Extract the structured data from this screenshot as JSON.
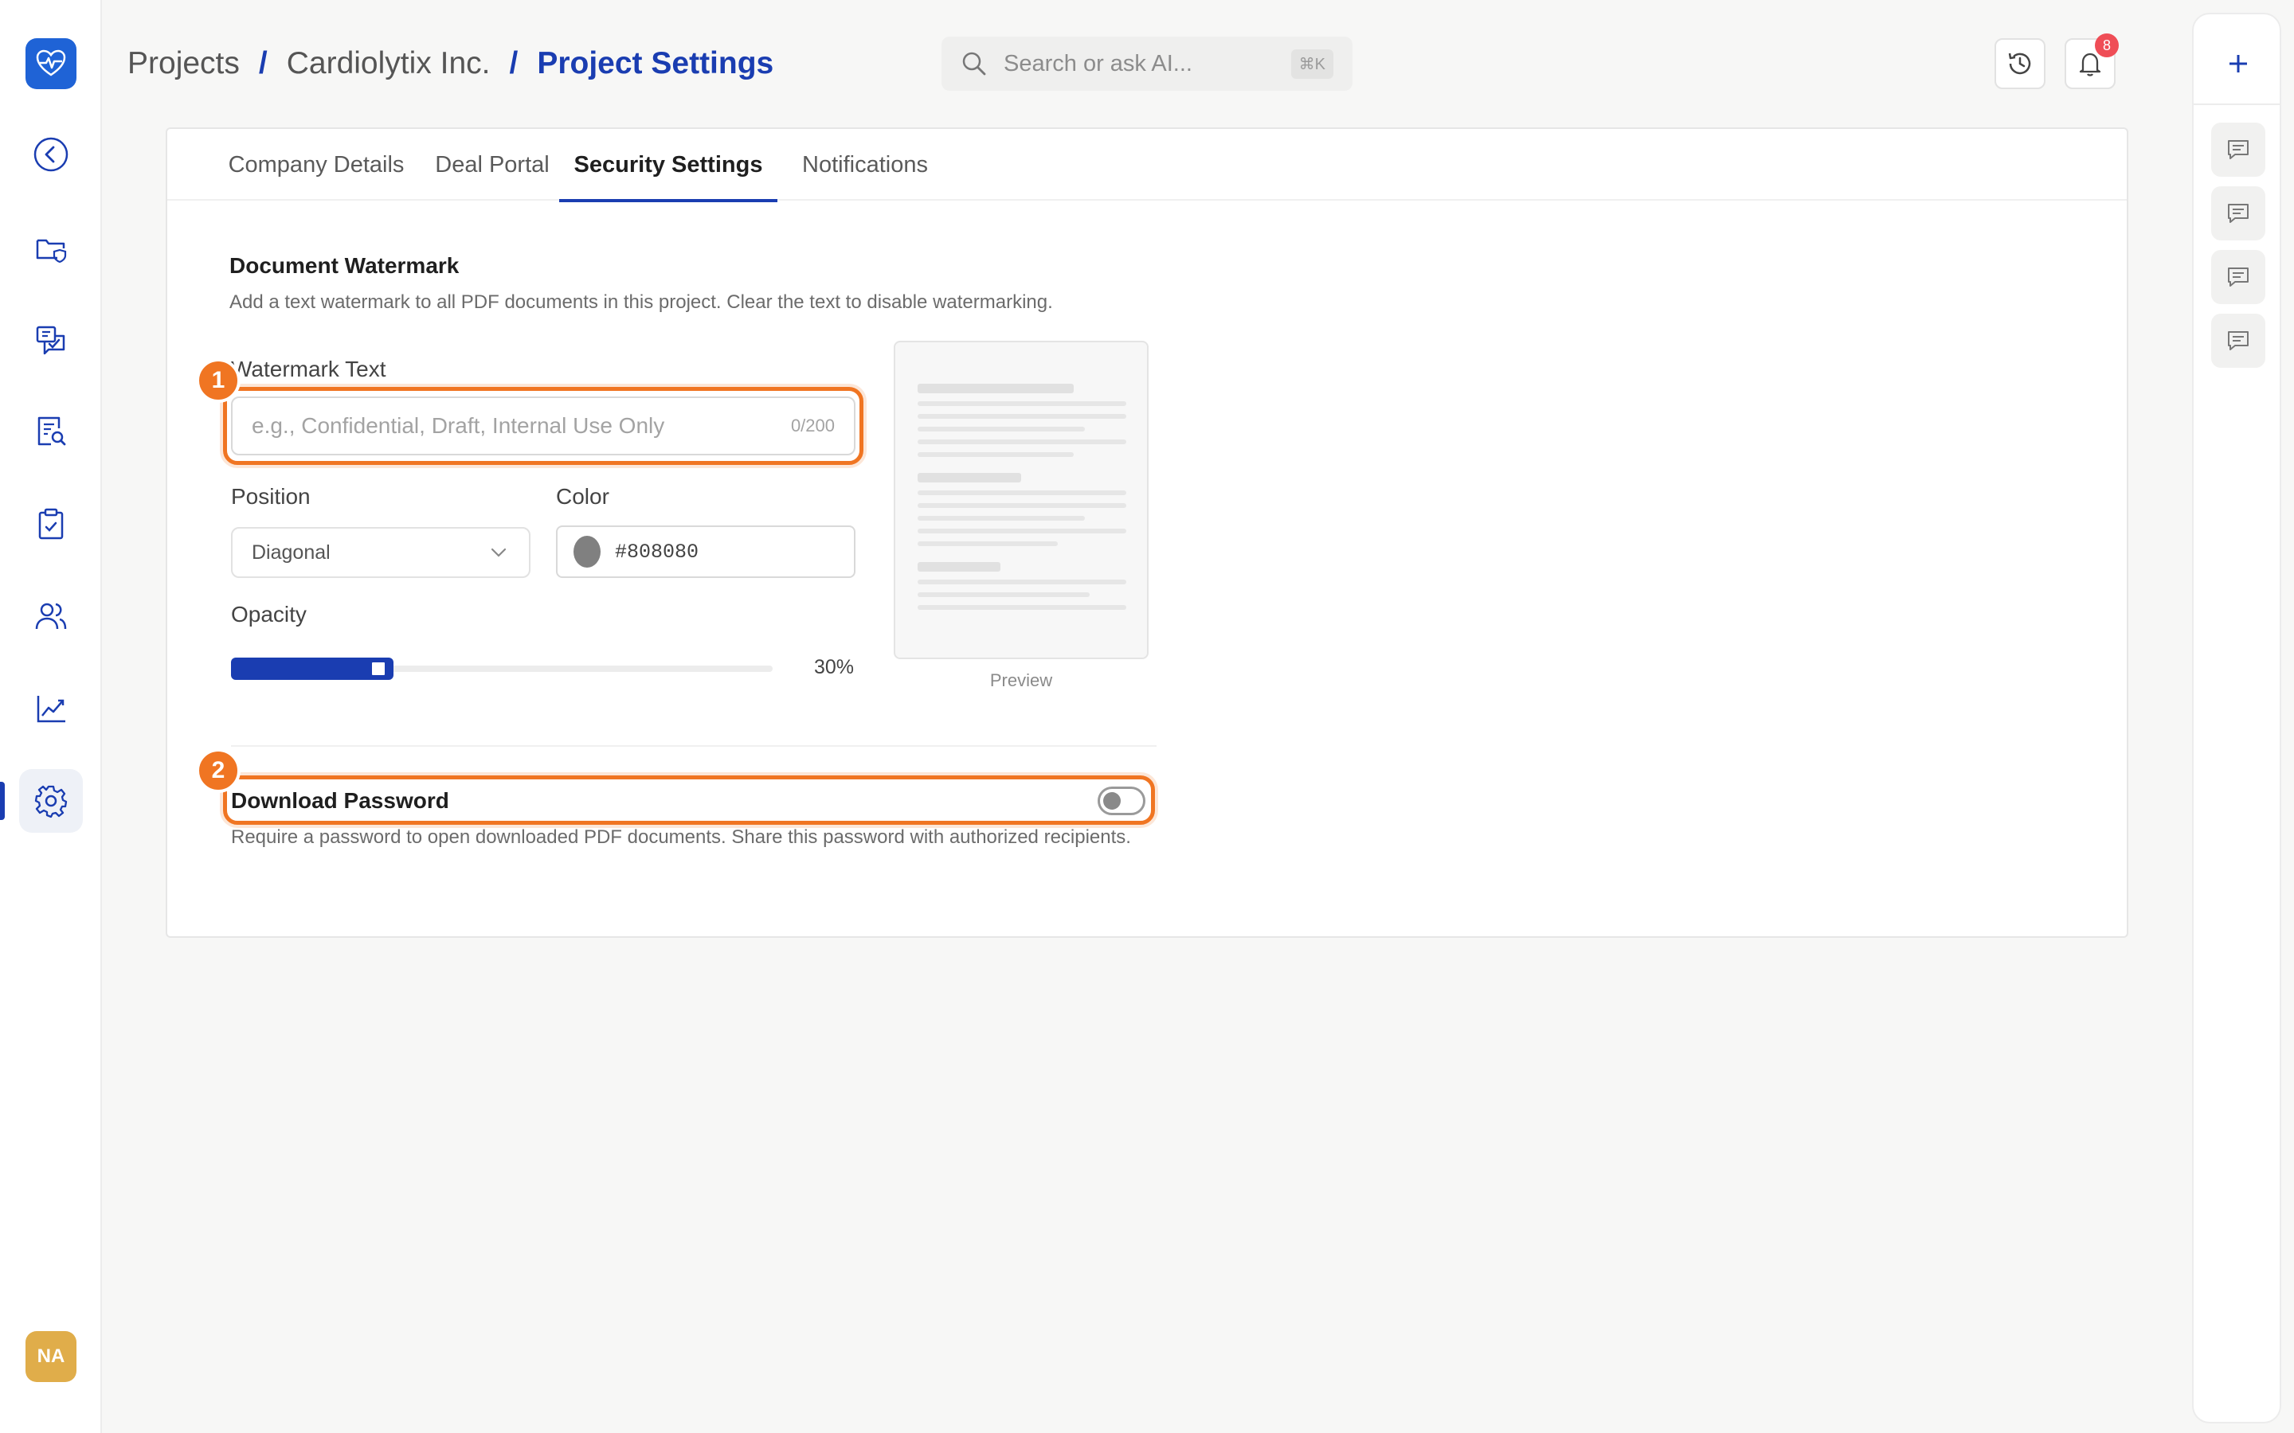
{
  "app": {
    "avatar_initials": "NA",
    "accent_color": "#1a3db1",
    "highlight_color": "#f07522"
  },
  "nav": {
    "items": [
      {
        "name": "back",
        "icon": "chevron-left-circle-icon"
      },
      {
        "name": "folders",
        "icon": "folder-shield-icon"
      },
      {
        "name": "qa",
        "icon": "chat-check-icon"
      },
      {
        "name": "review",
        "icon": "document-search-icon"
      },
      {
        "name": "tasks",
        "icon": "clipboard-check-icon"
      },
      {
        "name": "users",
        "icon": "users-icon"
      },
      {
        "name": "analytics",
        "icon": "line-chart-icon"
      },
      {
        "name": "settings",
        "icon": "gear-icon",
        "active": true
      }
    ]
  },
  "breadcrumb": {
    "items": [
      "Projects",
      "Cardiolytix Inc.",
      "Project Settings"
    ],
    "separator": "/"
  },
  "search": {
    "placeholder": "Search or ask AI...",
    "shortcut": "⌘K"
  },
  "notifications": {
    "count": "8"
  },
  "tabs": [
    {
      "label": "Company Details",
      "active": false
    },
    {
      "label": "Deal Portal",
      "active": false
    },
    {
      "label": "Security Settings",
      "active": true
    },
    {
      "label": "Notifications",
      "active": false
    }
  ],
  "watermark": {
    "title": "Document Watermark",
    "description": "Add a text watermark to all PDF documents in this project. Clear the text to disable watermarking.",
    "text_label": "Watermark Text",
    "text_placeholder": "e.g., Confidential, Draft, Internal Use Only",
    "text_value": "",
    "char_count": "0/200",
    "position_label": "Position",
    "position_value": "Diagonal",
    "color_label": "Color",
    "color_value": "#808080",
    "opacity_label": "Opacity",
    "opacity_value": 0.3,
    "opacity_text": "30%",
    "preview_label": "Preview"
  },
  "download_password": {
    "title": "Download Password",
    "description": "Require a password to open downloaded PDF documents. Share this password with authorized recipients.",
    "enabled": false
  },
  "annotations": [
    {
      "number": "1"
    },
    {
      "number": "2"
    }
  ]
}
